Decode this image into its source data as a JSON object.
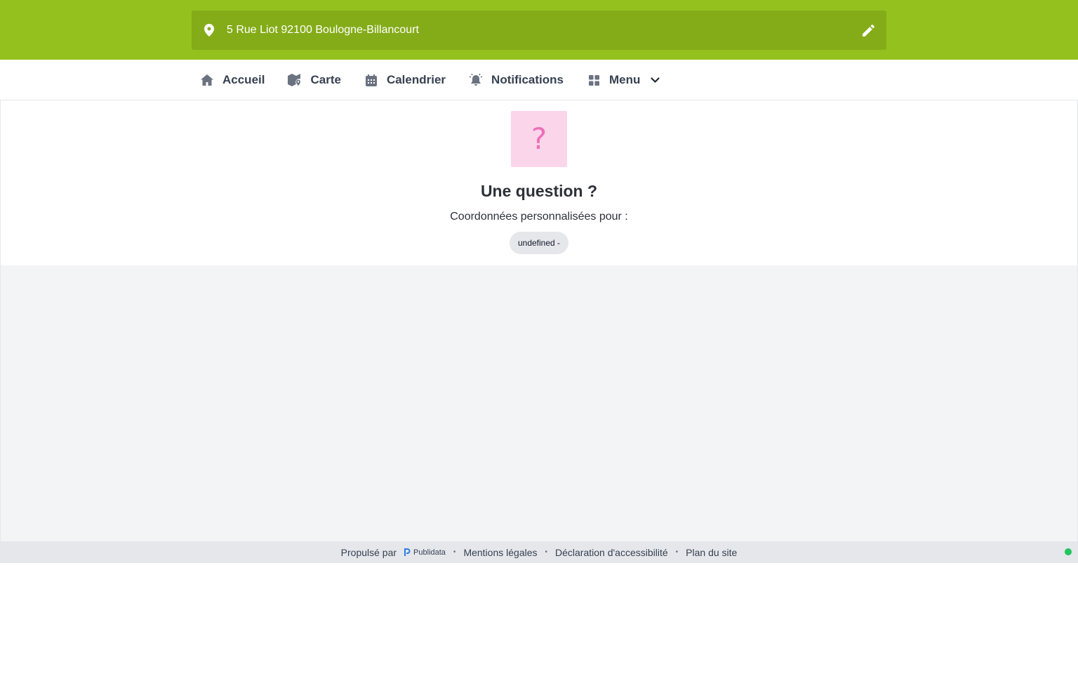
{
  "header": {
    "address": "5 Rue Liot 92100 Boulogne-Billancourt",
    "icons": {
      "location": "map-pin-icon",
      "edit": "pencil-icon"
    },
    "bg_color": "#95c11f",
    "address_bg_color": "#84ac18"
  },
  "nav": {
    "items": [
      {
        "label": "Accueil",
        "icon": "home-icon"
      },
      {
        "label": "Carte",
        "icon": "map-icon"
      },
      {
        "label": "Calendrier",
        "icon": "calendar-icon"
      },
      {
        "label": "Notifications",
        "icon": "bell-icon"
      },
      {
        "label": "Menu",
        "icon": "grid-icon"
      }
    ]
  },
  "main": {
    "question_mark": "?",
    "title": "Une question ?",
    "subtitle": "Coordonnées personnalisées pour :",
    "pill": "undefined -"
  },
  "footer": {
    "powered_by": "Propulsé par",
    "brand": "Publidata",
    "links": [
      "Mentions légales",
      "Déclaration d'accessibilité",
      "Plan du site"
    ],
    "status_color": "#22c55e"
  }
}
